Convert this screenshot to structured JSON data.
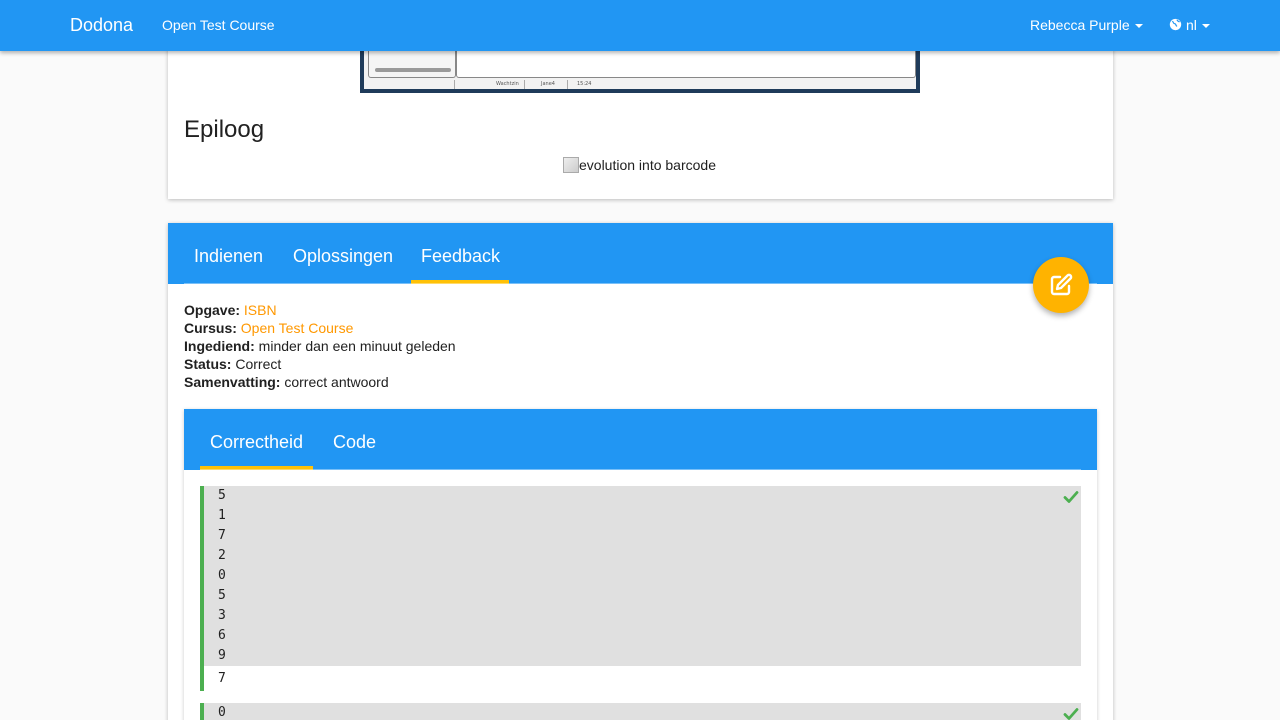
{
  "navbar": {
    "brand": "Dodona",
    "course": "Open Test Course",
    "user": "Rebecca Purple",
    "language": "nl"
  },
  "description": {
    "screenshot_status_left": "Wachtzin",
    "screenshot_status_mid": "Jane4",
    "screenshot_status_right": "15:24",
    "heading": "Epiloog",
    "image_alt": "evolution into barcode"
  },
  "submission_tabs": [
    {
      "label": "Indienen"
    },
    {
      "label": "Oplossingen"
    },
    {
      "label": "Feedback"
    }
  ],
  "feedback": {
    "exercise_label": "Opgave:",
    "exercise_value": "ISBN",
    "course_label": "Cursus:",
    "course_value": "Open Test Course",
    "submitted_label": "Ingediend:",
    "submitted_value": "minder dan een minuut geleden",
    "status_label": "Status:",
    "status_value": "Correct",
    "summary_label": "Samenvatting:",
    "summary_value": "correct antwoord"
  },
  "result_tabs": [
    {
      "label": "Correctheid"
    },
    {
      "label": "Code"
    }
  ],
  "testcases": [
    {
      "output": [
        "5",
        "1",
        "7",
        "2",
        "0",
        "5",
        "3",
        "6",
        "9"
      ],
      "input": "7",
      "status": "correct"
    },
    {
      "output": [
        "0"
      ],
      "input": "",
      "status": "correct"
    }
  ],
  "colors": {
    "primary": "#2196f3",
    "accent": "#ffc107",
    "link": "#ff9800",
    "success": "#4caf50"
  }
}
